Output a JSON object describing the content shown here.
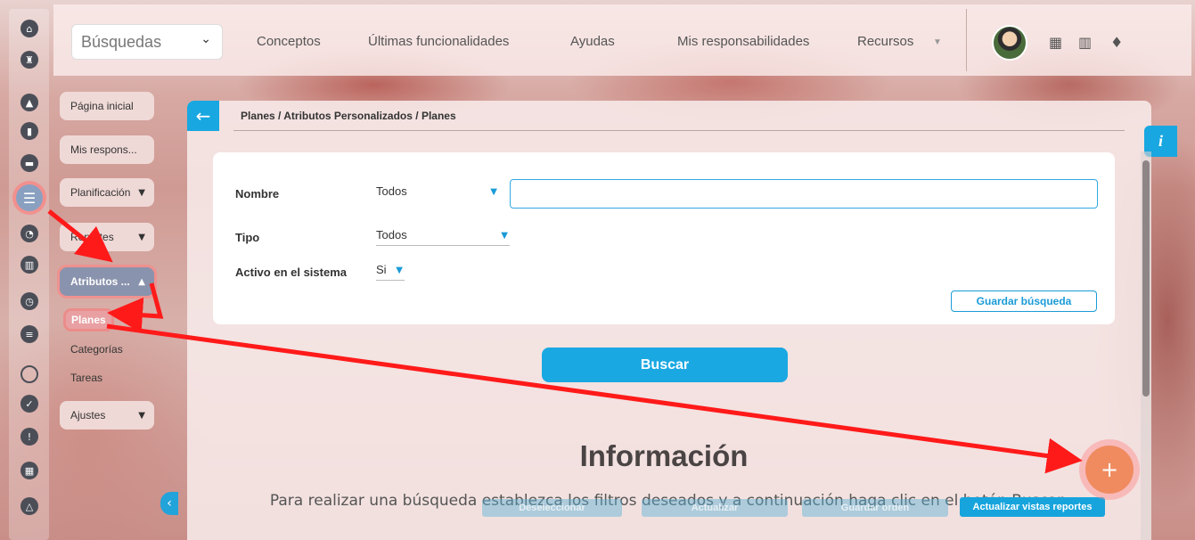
{
  "topbar": {
    "search_select": "Búsquedas",
    "nav": [
      "Conceptos",
      "Últimas funcionalidades",
      "Ayudas",
      "Mis responsabilidades",
      "Recursos"
    ]
  },
  "icons": {
    "rail": [
      "home-icon",
      "tower-icon",
      "triangle-icon",
      "bar-chart-icon",
      "presentation-icon",
      "filter-lines-icon",
      "pie-chart-icon",
      "books-icon",
      "clock-icon",
      "list-icon",
      "circle-icon",
      "check-icon",
      "warning-icon",
      "calendar-icon",
      "network-icon"
    ],
    "top": [
      "calendar-grid-icon",
      "books-icon",
      "bell-icon"
    ]
  },
  "sidebar": {
    "items": [
      {
        "label": "Página inicial"
      },
      {
        "label": "Mis respons..."
      },
      {
        "label": "Planificación"
      },
      {
        "label": "Reportes"
      },
      {
        "label": "Atributos ..."
      },
      {
        "label": "Ajustes"
      }
    ],
    "subitems": [
      "Planes",
      "Categorías",
      "Tareas"
    ]
  },
  "main": {
    "breadcrumb": "Planes / Atributos Personalizados / Planes",
    "filters": {
      "nombre_label": "Nombre",
      "nombre_value": "Todos",
      "tipo_label": "Tipo",
      "tipo_value": "Todos",
      "activo_label": "Activo en el sistema",
      "activo_value": "Si"
    },
    "save_search": "Guardar búsqueda",
    "search_button": "Buscar",
    "info_title": "Información",
    "info_text": "Para realizar una búsqueda establezca los filtros deseados y a continuación haga clic en el botón Buscar.",
    "ghost_buttons": [
      "Deseleccionar",
      "Actualizar",
      "Guardar orden"
    ],
    "update_reports": "Actualizar vistas reportes"
  },
  "colors": {
    "accent": "#1aa8e2",
    "fab": "#f08b60",
    "annotation_arrow": "#ff1a1a"
  }
}
